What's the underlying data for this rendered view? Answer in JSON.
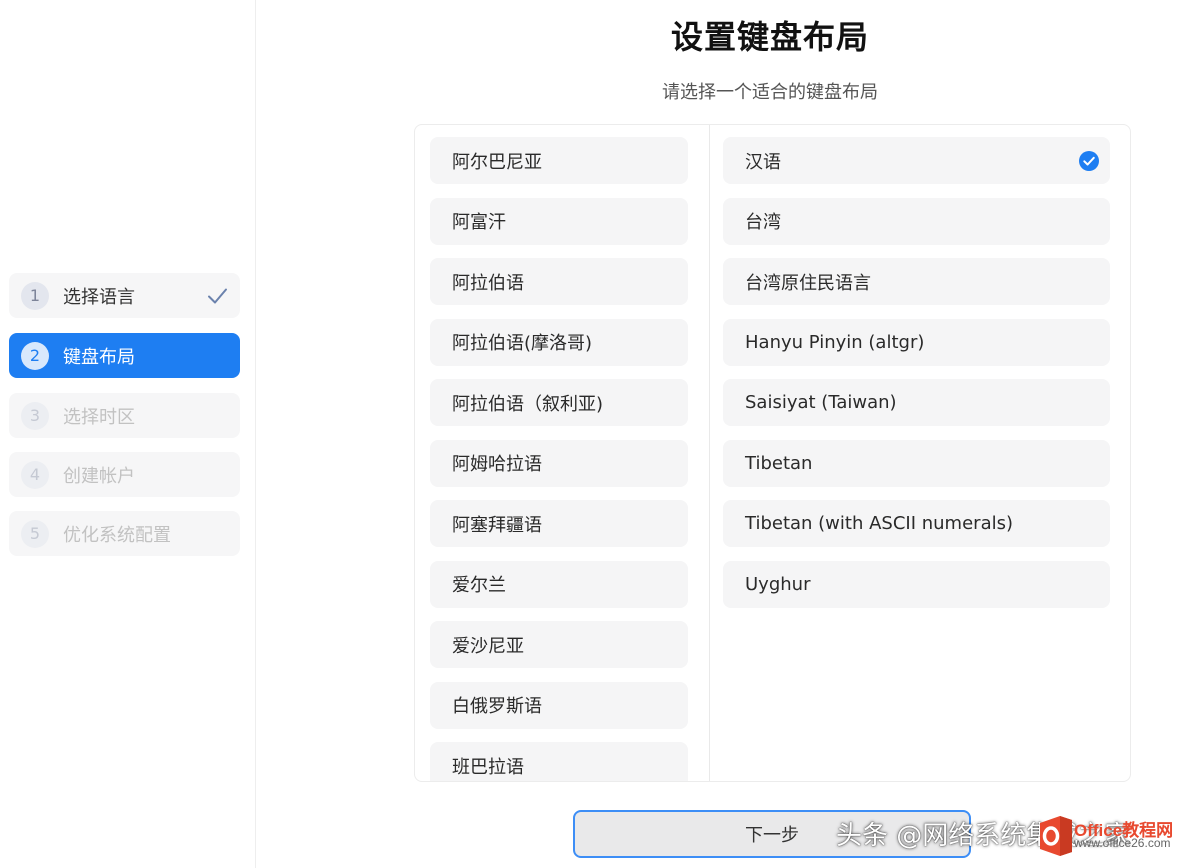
{
  "header": {
    "title": "设置键盘布局",
    "subtitle": "请选择一个适合的键盘布局"
  },
  "sidebar": {
    "steps": [
      {
        "number": "1",
        "label": "选择语言",
        "state": "done"
      },
      {
        "number": "2",
        "label": "键盘布局",
        "state": "active"
      },
      {
        "number": "3",
        "label": "选择时区",
        "state": "disabled"
      },
      {
        "number": "4",
        "label": "创建帐户",
        "state": "disabled"
      },
      {
        "number": "5",
        "label": "优化系统配置",
        "state": "disabled"
      }
    ]
  },
  "layouts": {
    "languages": [
      "阿尔巴尼亚",
      "阿富汗",
      "阿拉伯语",
      "阿拉伯语(摩洛哥)",
      "阿拉伯语（叙利亚)",
      "阿姆哈拉语",
      "阿塞拜疆语",
      "爱尔兰",
      "爱沙尼亚",
      "白俄罗斯语",
      "班巴拉语"
    ],
    "variants": [
      "汉语",
      "台湾",
      "台湾原住民语言",
      "Hanyu Pinyin (altgr)",
      "Saisiyat (Taiwan)",
      "Tibetan",
      "Tibetan (with ASCII numerals)",
      "Uyghur"
    ],
    "selected_variant": "汉语"
  },
  "footer": {
    "next_label": "下一步"
  },
  "watermark": {
    "text": "头条 @网络系统集成之家",
    "site": "Office教程网",
    "url": "www.office26.com"
  },
  "colors": {
    "accent": "#1e7ef2",
    "check_done": "#6b82ad"
  },
  "icons": {
    "step_done": "checkmark-icon",
    "selected": "check-circle-icon",
    "logo": "office-logo-icon"
  }
}
